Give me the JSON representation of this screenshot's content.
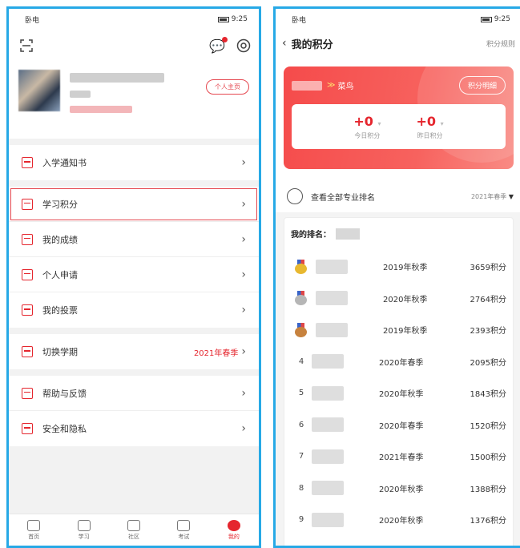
{
  "left": {
    "status": {
      "carrier": "卧电",
      "time": "9:25"
    },
    "profile": {
      "homepage_button": "个人主页"
    },
    "menu_groups": [
      [
        {
          "label": "入学通知书",
          "value": ""
        }
      ],
      [
        {
          "label": "学习积分",
          "value": ""
        },
        {
          "label": "我的成绩",
          "value": ""
        },
        {
          "label": "个人申请",
          "value": ""
        },
        {
          "label": "我的投票",
          "value": ""
        }
      ],
      [
        {
          "label": "切换学期",
          "value": "2021年春季"
        }
      ],
      [
        {
          "label": "帮助与反馈",
          "value": ""
        },
        {
          "label": "安全和隐私",
          "value": ""
        }
      ]
    ],
    "tabs": [
      "首页",
      "学习",
      "社区",
      "考试",
      "我的"
    ]
  },
  "right": {
    "status": {
      "carrier": "卧电",
      "time": "9:25"
    },
    "header": {
      "title": "我的积分",
      "rules": "积分规则"
    },
    "card": {
      "level": "菜鸟",
      "detail_button": "积分明细",
      "today_value": "+0",
      "today_label": "今日积分",
      "yesterday_value": "+0",
      "yesterday_label": "昨日积分"
    },
    "rank_all_label": "查看全部专业排名",
    "semester": "2021年春季",
    "my_rank_label": "我的排名：",
    "ranking": [
      {
        "rank": "1",
        "semester": "2019年秋季",
        "points": "3659积分",
        "medal": "#e8b830"
      },
      {
        "rank": "2",
        "semester": "2020年秋季",
        "points": "2764积分",
        "medal": "#b6b6b6"
      },
      {
        "rank": "3",
        "semester": "2019年秋季",
        "points": "2393积分",
        "medal": "#c7823e"
      },
      {
        "rank": "4",
        "semester": "2020年春季",
        "points": "2095积分",
        "medal": ""
      },
      {
        "rank": "5",
        "semester": "2020年秋季",
        "points": "1843积分",
        "medal": ""
      },
      {
        "rank": "6",
        "semester": "2020年春季",
        "points": "1520积分",
        "medal": ""
      },
      {
        "rank": "7",
        "semester": "2021年春季",
        "points": "1500积分",
        "medal": ""
      },
      {
        "rank": "8",
        "semester": "2020年秋季",
        "points": "1388积分",
        "medal": ""
      },
      {
        "rank": "9",
        "semester": "2020年秋季",
        "points": "1376积分",
        "medal": ""
      }
    ]
  }
}
